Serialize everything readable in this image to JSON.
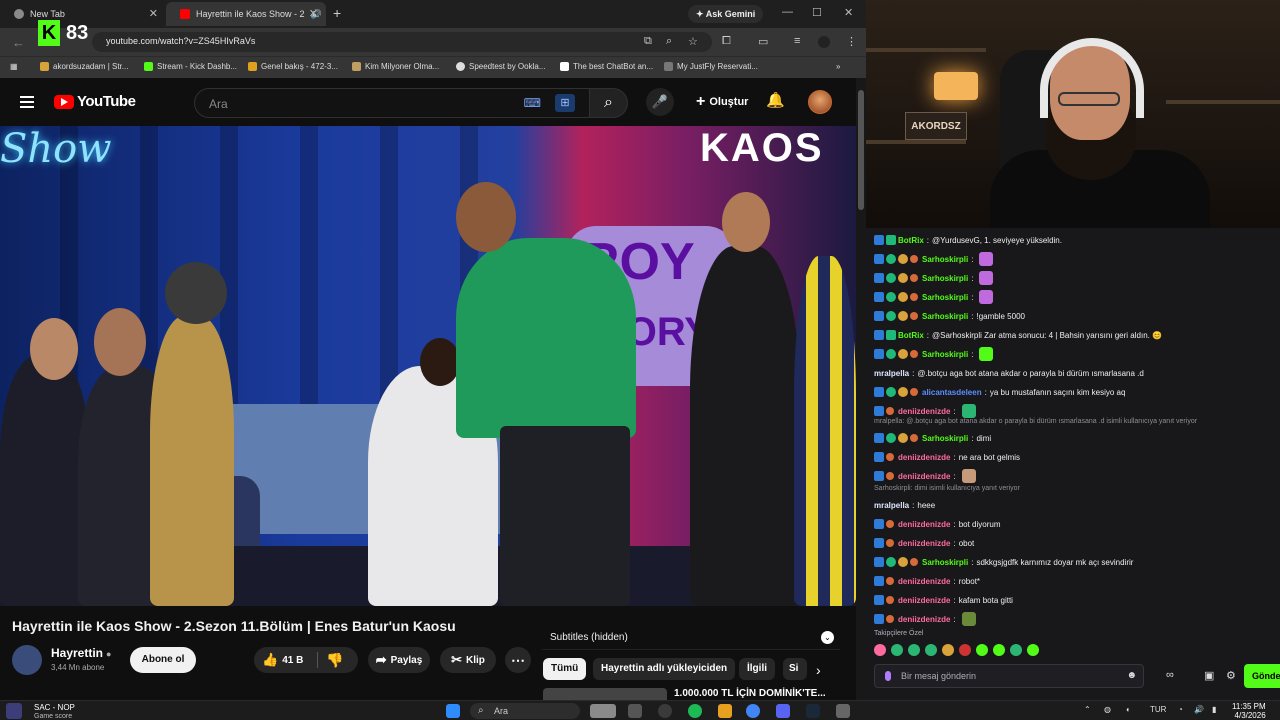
{
  "browser": {
    "tabs": [
      {
        "title": "New Tab"
      },
      {
        "title": "Hayrettin ile Kaos Show - 2"
      }
    ],
    "ask_gemini": "Ask Gemini",
    "url": "youtube.com/watch?v=ZS45HIvRaVs",
    "overlay_score": "83",
    "bookmarks": [
      {
        "label": "akordsuzadam | Str..."
      },
      {
        "label": "Stream - Kick Dashb..."
      },
      {
        "label": "Genel bakış - 472-3..."
      },
      {
        "label": "Kim Milyoner Olma..."
      },
      {
        "label": "Speedtest by Ookla..."
      },
      {
        "label": "The best ChatBot an..."
      },
      {
        "label": "My JustFly Reservati..."
      }
    ]
  },
  "youtube": {
    "logo": "YouTube",
    "search_placeholder": "Ara",
    "create_label": "Oluştur",
    "video": {
      "title": "Hayrettin ile Kaos Show - 2.Sezon 11.Bölüm | Enes Batur'un Kaosu",
      "channel": "Hayrettin",
      "subscribers": "3,44 Mn abone",
      "subscribe_label": "Abone ol",
      "likes": "41 B",
      "share_label": "Paylaş",
      "clip_label": "Klip",
      "scene_text_left": "Show",
      "scene_text_right": "KAOS",
      "scene_sign": [
        "ROY",
        "TORY"
      ]
    },
    "subtitles_label": "Subtitles (hidden)",
    "chips": [
      "Tümü",
      "Hayrettin adlı yükleyiciden",
      "İlgili",
      "Si"
    ],
    "next_video_title": "1.000.000 TL İÇİN DOMİNİK'TE..."
  },
  "stream": {
    "cam_sign": "AKORDSZ",
    "chat": [
      {
        "user": "BotRix",
        "color": "#53fc18",
        "badges": [
          "mod",
          "bot"
        ],
        "text": "@YurdusevG, 1. seviyeye yükseldin."
      },
      {
        "user": "Sarhoskirpli",
        "color": "#53fc18",
        "badges": [
          "mod",
          "sub",
          "gift",
          "fire"
        ],
        "text": "",
        "emote": "#c06ae0"
      },
      {
        "user": "Sarhoskirpli",
        "color": "#53fc18",
        "badges": [
          "mod",
          "sub",
          "gift",
          "fire"
        ],
        "text": "",
        "emote": "#c06ae0"
      },
      {
        "user": "Sarhoskirpli",
        "color": "#53fc18",
        "badges": [
          "mod",
          "sub",
          "gift",
          "fire"
        ],
        "text": "",
        "emote": "#c06ae0"
      },
      {
        "user": "Sarhoskirpli",
        "color": "#53fc18",
        "badges": [
          "mod",
          "sub",
          "gift",
          "fire"
        ],
        "text": "!gamble 5000"
      },
      {
        "user": "BotRix",
        "color": "#53fc18",
        "badges": [
          "mod",
          "bot"
        ],
        "text": "@Sarhoskirpli Zar atma sonucu: 4 | Bahsin yarısını geri aldın. 😊"
      },
      {
        "user": "Sarhoskirpli",
        "color": "#53fc18",
        "badges": [
          "mod",
          "sub",
          "gift",
          "fire"
        ],
        "text": "",
        "emote": "#53fc18"
      },
      {
        "user": "mralpella",
        "color": "#dfe7ff",
        "badges": [],
        "text": "@.botçu aga bot atana akdar o parayla bi dürüm ısmarlasana .d"
      },
      {
        "user": "alicantasdeleen",
        "color": "#5b8dff",
        "badges": [
          "mod",
          "sub",
          "gift",
          "fire"
        ],
        "text": "ya bu mustafanın saçını kim kesiyo aq"
      },
      {
        "user": "deniizdenizde",
        "color": "#ff6b9b",
        "badges": [
          "mod",
          "fire"
        ],
        "text": "",
        "emote": "#2bb673"
      },
      {
        "user": "Sarhoskirpli",
        "color": "#53fc18",
        "badges": [
          "mod",
          "sub",
          "gift",
          "fire"
        ],
        "text": "dimi"
      },
      {
        "user": "deniizdenizde",
        "color": "#ff6b9b",
        "badges": [
          "mod",
          "fire"
        ],
        "text": "ne ara bot gelmis"
      },
      {
        "user": "deniizdenizde",
        "color": "#ff6b9b",
        "badges": [
          "mod",
          "fire"
        ],
        "text": "",
        "emote": "#c79a7a"
      },
      {
        "user": "mralpella",
        "color": "#dfe7ff",
        "badges": [],
        "text": "heee"
      },
      {
        "user": "deniizdenizde",
        "color": "#ff6b9b",
        "badges": [
          "mod",
          "fire"
        ],
        "text": "bot diyorum"
      },
      {
        "user": "deniizdenizde",
        "color": "#ff6b9b",
        "badges": [
          "mod",
          "fire"
        ],
        "text": "obot"
      },
      {
        "user": "Sarhoskirpli",
        "color": "#53fc18",
        "badges": [
          "mod",
          "sub",
          "gift",
          "fire"
        ],
        "text": "sdkkgsjgdfk karnımız doyar mk açı sevindirir"
      },
      {
        "user": "deniizdenizde",
        "color": "#ff6b9b",
        "badges": [
          "mod",
          "fire"
        ],
        "text": "robot*"
      },
      {
        "user": "deniizdenizde",
        "color": "#ff6b9b",
        "badges": [
          "mod",
          "fire"
        ],
        "text": "kafam bota gitti"
      },
      {
        "user": "deniizdenizde",
        "color": "#ff6b9b",
        "badges": [
          "mod",
          "fire"
        ],
        "text": "",
        "emote": "#6a8a3a"
      }
    ],
    "replies": [
      "mralpella: @.botçu aga bot atana akdar o parayla bi dürüm ısmarlasana .d isimli kullanıcıya yanıt veriyor",
      "Sarhoskirpli: dimi isimli kullanıcıya yanıt veriyor"
    ],
    "followers_only": "Takipçilere Özel",
    "emote_bar": [
      "#ff6b9b",
      "#2bb673",
      "#2bb673",
      "#2bb673",
      "#d9a23a",
      "#c33",
      "#53fc18",
      "#53fc18",
      "#2bb673",
      "#53fc18"
    ],
    "chat_placeholder": "Bir mesaj gönderin",
    "send_label": "Gönder"
  },
  "taskbar": {
    "game_name": "SAC - NOP",
    "game_sub": "Game score",
    "search": "Ara",
    "lang": "TUR",
    "time": "11:35 PM",
    "date": "4/3/2026"
  },
  "colors": {
    "kick_green": "#53fc18",
    "youtube_red": "#ff0000"
  }
}
